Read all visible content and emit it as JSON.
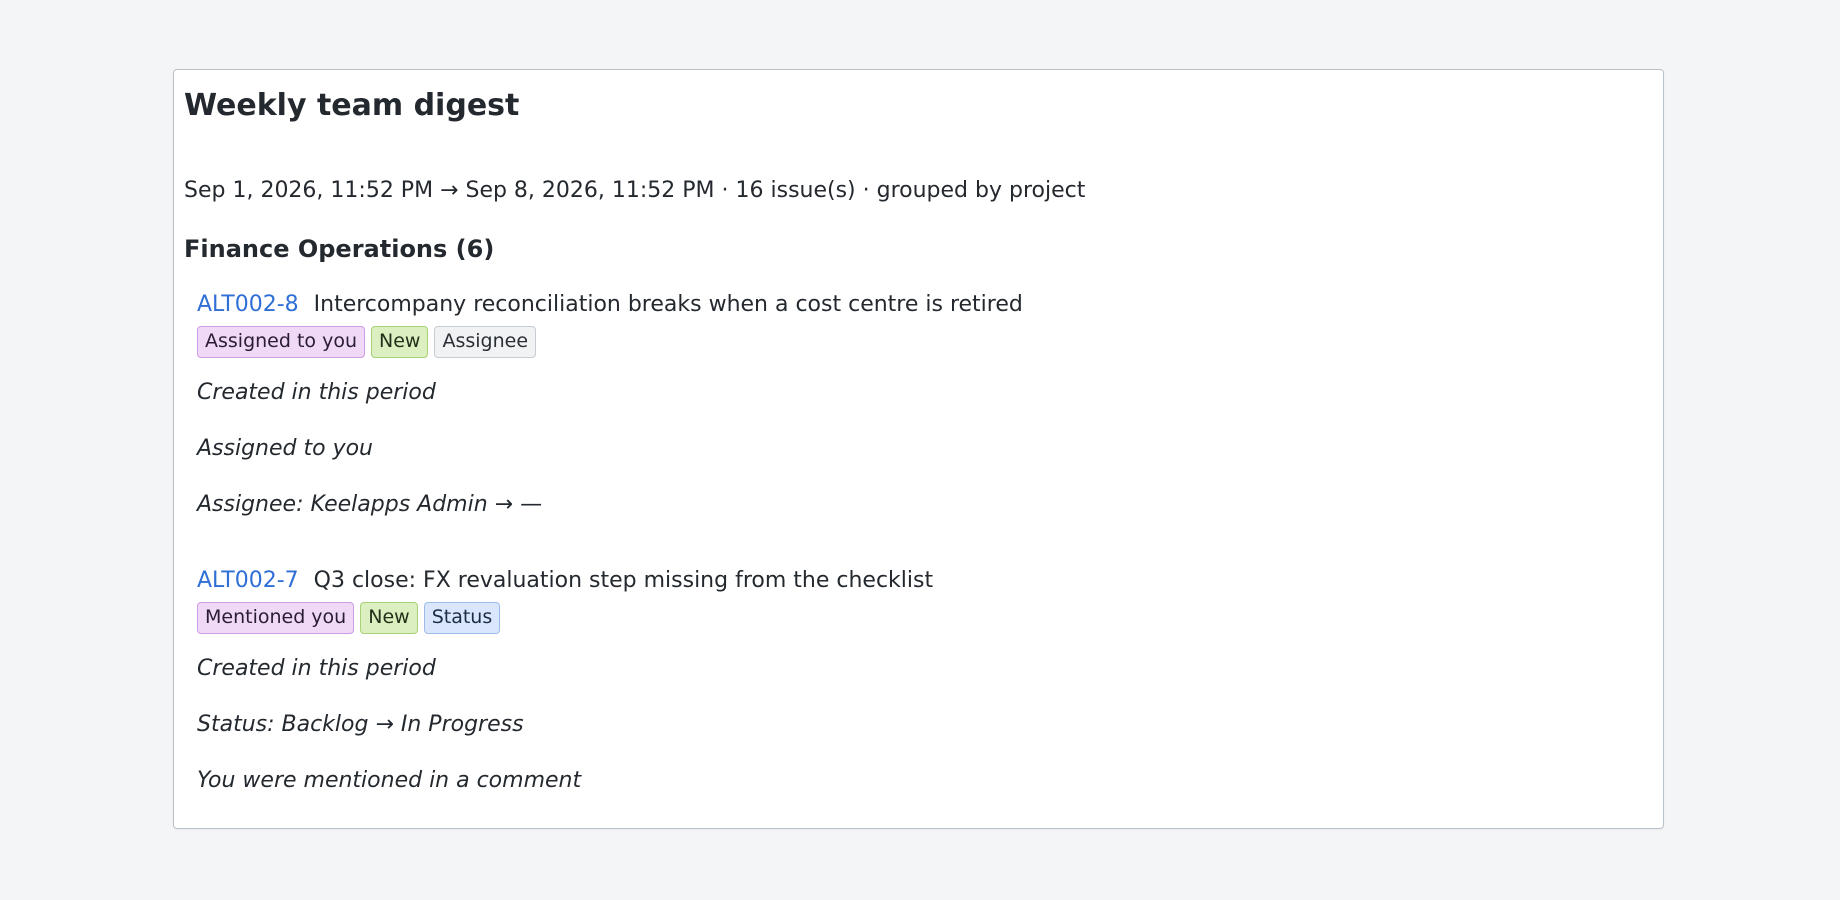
{
  "digest": {
    "title": "Weekly team digest",
    "meta": "Sep 1, 2026, 11:52 PM → Sep 8, 2026, 11:52 PM · 16 issue(s) · grouped by project"
  },
  "groups": [
    {
      "heading": "Finance Operations (6)",
      "issues": [
        {
          "key": "ALT002-8",
          "title": "Intercompany reconciliation breaks when a cost centre is retired",
          "badges": [
            "Assigned to you",
            "New",
            "Assignee"
          ],
          "events": [
            "Created in this period",
            "Assigned to you",
            "Assignee: Keelapps Admin → —"
          ]
        },
        {
          "key": "ALT002-7",
          "title": "Q3 close: FX revaluation step missing from the checklist",
          "badges": [
            "Mentioned you",
            "New",
            "Status"
          ],
          "events": [
            "Created in this period",
            "Status: Backlog → In Progress",
            "You were mentioned in a comment"
          ]
        }
      ]
    }
  ],
  "colors": {
    "link": "#2f6fd6",
    "badge_purple": "#efd9f7",
    "badge_green": "#dcefc0",
    "badge_gray": "#f1f2f4",
    "badge_blue": "#d9e6fb",
    "page_background": "#f4f5f7"
  }
}
